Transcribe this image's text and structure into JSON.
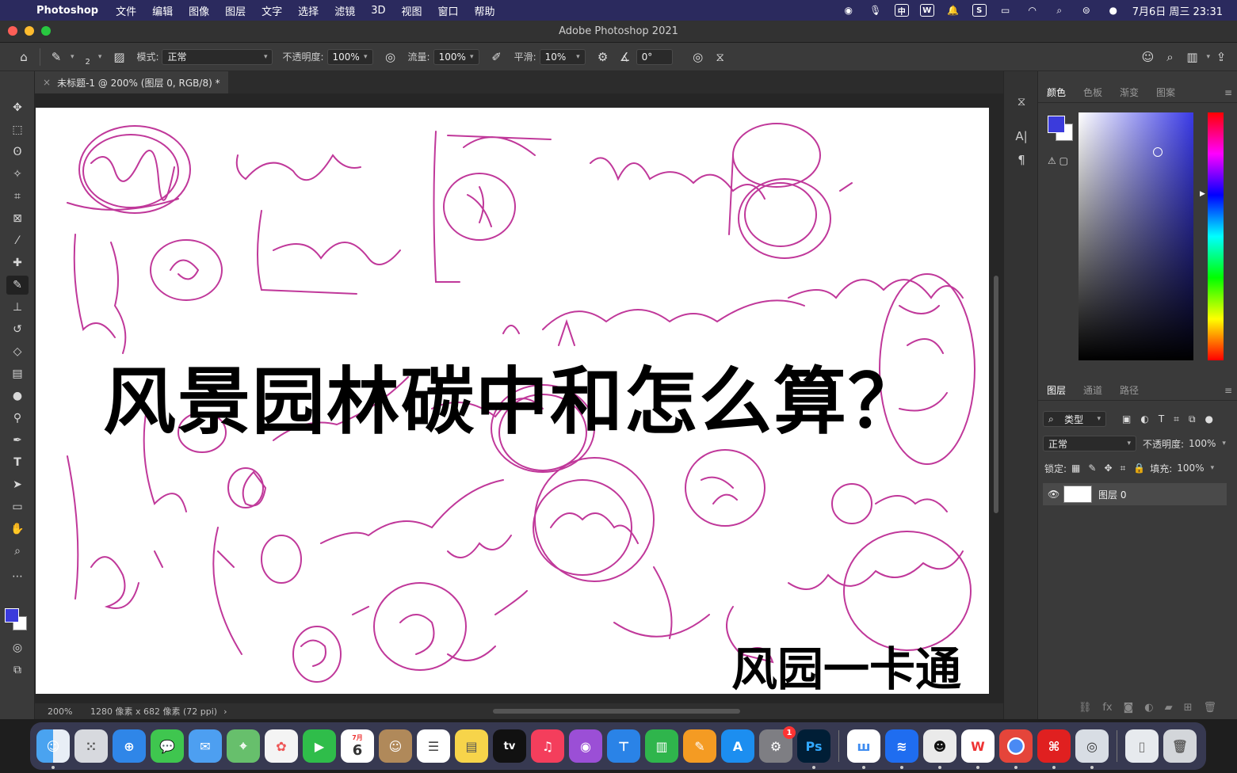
{
  "menubar": {
    "app_name": "Photoshop",
    "items": [
      "文件",
      "编辑",
      "图像",
      "图层",
      "文字",
      "选择",
      "滤镜",
      "3D",
      "视图",
      "窗口",
      "帮助"
    ],
    "clock": "7月6日 周三 23:31",
    "input_method": "中"
  },
  "window": {
    "title": "Adobe Photoshop 2021"
  },
  "options_bar": {
    "brush_size": "2",
    "mode_label": "模式:",
    "mode_value": "正常",
    "opacity_label": "不透明度:",
    "opacity_value": "100%",
    "flow_label": "流量:",
    "flow_value": "100%",
    "smoothing_label": "平滑:",
    "smoothing_value": "10%",
    "angle_value": "0°"
  },
  "document": {
    "tab_label": "未标题-1 @ 200% (图层 0, RGB/8) *",
    "overlay_title": "风景园林碳中和怎么算？",
    "overlay_subtitle": "风园一卡通"
  },
  "status_bar": {
    "zoom": "200%",
    "doc_info": "1280 像素 x 682 像素 (72 ppi)"
  },
  "color_panel": {
    "tabs": [
      "颜色",
      "色板",
      "渐变",
      "图案"
    ],
    "foreground_color": "#3b3bdc",
    "background_color": "#ffffff"
  },
  "layers_panel": {
    "tabs": [
      "图层",
      "通道",
      "路径"
    ],
    "filter_label": "类型",
    "blend_mode": "正常",
    "opacity_label": "不透明度:",
    "opacity_value": "100%",
    "lock_label": "锁定:",
    "fill_label": "填充:",
    "fill_value": "100%",
    "layers": [
      {
        "name": "图层 0",
        "visible": true
      }
    ]
  },
  "dock": {
    "calendar_day": "6",
    "calendar_month": "7月",
    "appletv_label": "tv",
    "ps_label": "Ps",
    "notification_badge": "1"
  },
  "colors": {
    "menubar_bg": "#2b2a5e",
    "ink": "#c0389a",
    "panel_bg": "#3a3a3a"
  }
}
